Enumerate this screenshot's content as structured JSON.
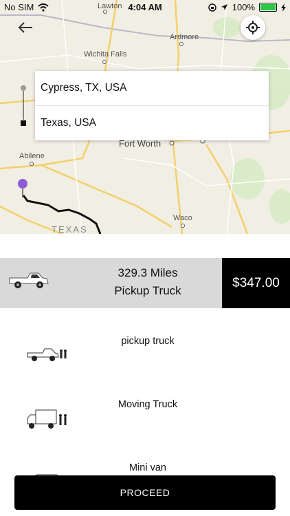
{
  "status_bar": {
    "carrier": "No SIM",
    "time": "4:04 AM",
    "battery": "100%"
  },
  "map": {
    "labels": [
      {
        "id": "lawton",
        "text": "Lawton"
      },
      {
        "id": "ardmore",
        "text": "Ardmore"
      },
      {
        "id": "wichita-falls",
        "text": "Wichita Falls"
      },
      {
        "id": "fort-worth",
        "text": "Fort Worth"
      },
      {
        "id": "abilene",
        "text": "Abilene"
      },
      {
        "id": "waco",
        "text": "Waco"
      },
      {
        "id": "texas",
        "text": "TEXAS"
      }
    ]
  },
  "route": {
    "origin": "Cypress, TX, USA",
    "destination": "Texas, USA"
  },
  "selected_quote": {
    "distance": "329.3 Miles",
    "vehicle": "Pickup Truck",
    "price": "$347.00"
  },
  "vehicle_options": [
    {
      "label": "pickup truck",
      "icon": "pickup-truck-icon"
    },
    {
      "label": "Moving Truck",
      "icon": "moving-truck-icon"
    },
    {
      "label": "Mini van",
      "icon": "minivan-icon"
    }
  ],
  "proceed_label": "PROCEED",
  "colors": {
    "route_pin": "#8f5cd6",
    "accent": "#000000",
    "battery": "#2cc84a"
  }
}
